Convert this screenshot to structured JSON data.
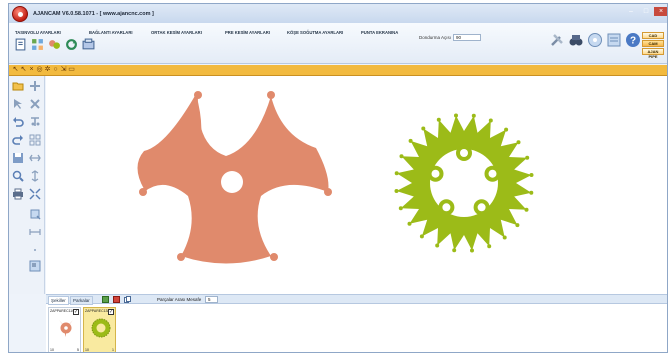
{
  "window": {
    "title": "AJANCAM V6.0.58.1071 - [ www.ajancnc.com ]"
  },
  "menu": [
    {
      "label": "TASINVOLU AYARLARI"
    },
    {
      "label": "BAĞLANTI AYARLARI"
    },
    {
      "label": "ORTAK KESİM AYARLARI"
    },
    {
      "label": "PRE KESİM AYARLARI"
    },
    {
      "label": "KÖŞE SOĞUTMA AYARLARI"
    },
    {
      "label": "PUNTA EKRANINA"
    }
  ],
  "rotation": {
    "label": "Dondurma Açısı",
    "value": "90"
  },
  "cad_buttons": [
    "CAD",
    "CAM",
    "AJAN PIPE"
  ],
  "bottom_panel": {
    "tabs": [
      "Şekiller",
      "Parkalar"
    ],
    "distance_label": "Parçalar Arası Mesafe",
    "distance_value": "5"
  },
  "parts": [
    {
      "name": "ZAPPAREC110",
      "count_left": "10",
      "count_right": "5"
    },
    {
      "name": "ZAPPAREC138",
      "count_left": "10",
      "count_right": "1"
    }
  ],
  "colors": {
    "part_orange": "#e08a6c",
    "part_green": "#9cbb18",
    "toolbar_orange": "#f2ba3f"
  }
}
